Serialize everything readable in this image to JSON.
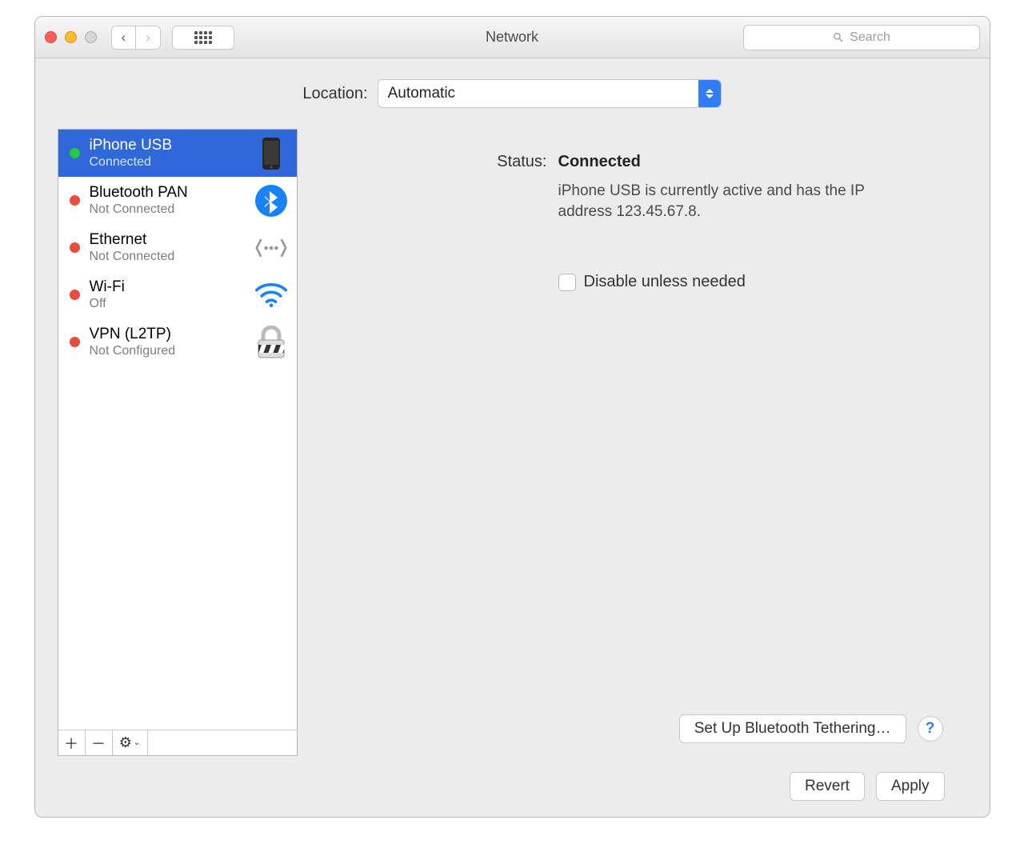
{
  "window_title": "Network",
  "search_placeholder": "Search",
  "location": {
    "label": "Location:",
    "value": "Automatic"
  },
  "services": [
    {
      "name": "iPhone USB",
      "sub": "Connected",
      "status": "green",
      "icon": "iphone",
      "selected": true
    },
    {
      "name": "Bluetooth PAN",
      "sub": "Not Connected",
      "status": "red",
      "icon": "bluetooth",
      "selected": false
    },
    {
      "name": "Ethernet",
      "sub": "Not Connected",
      "status": "red",
      "icon": "ethernet",
      "selected": false
    },
    {
      "name": "Wi-Fi",
      "sub": "Off",
      "status": "red",
      "icon": "wifi",
      "selected": false
    },
    {
      "name": "VPN (L2TP)",
      "sub": "Not Configured",
      "status": "red",
      "icon": "vpn",
      "selected": false
    }
  ],
  "detail": {
    "status_label": "Status:",
    "status_value": "Connected",
    "description": "iPhone USB is currently active and has the IP address 123.45.67.8.",
    "disable_label": "Disable unless needed",
    "tether_button": "Set Up Bluetooth Tethering…"
  },
  "footer": {
    "revert": "Revert",
    "apply": "Apply"
  }
}
